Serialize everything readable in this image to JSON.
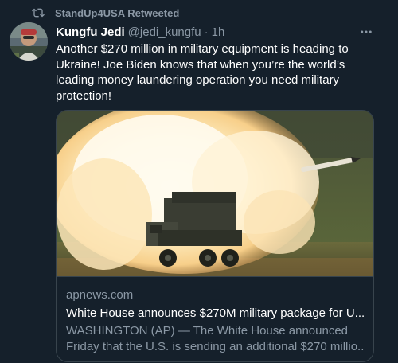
{
  "retweet": {
    "label": "StandUp4USA Retweeted",
    "icon": "retweet-icon"
  },
  "author": {
    "display_name": "Kungfu Jedi",
    "handle": "@jedi_kungfu",
    "separator": "·",
    "time": "1h",
    "avatar_icon": "avatar"
  },
  "tweet": {
    "text": "Another $270 million in military equipment is heading to Ukraine! Joe Biden knows that when you’re the world’s leading money laundering operation you need military protection!"
  },
  "card": {
    "domain": "apnews.com",
    "title": "White House announces $270M military package for U...",
    "description_line1": "WASHINGTON (AP) — The White House announced",
    "description_line2": "Friday that the U.S. is sending an additional $270 millio..."
  },
  "colors": {
    "background": "#15202b",
    "secondary_text": "#8b98a5",
    "border": "#38444d"
  }
}
